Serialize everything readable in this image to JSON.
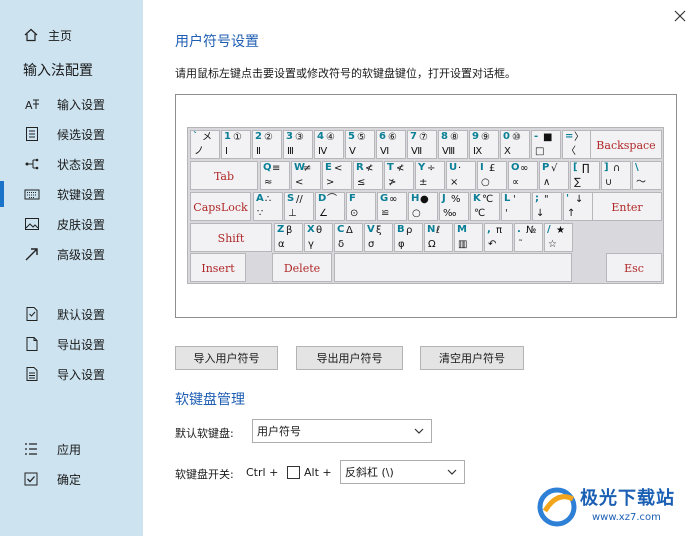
{
  "sidebar": {
    "home": "主页",
    "heading": "输入法配置",
    "items": [
      {
        "label": "输入设置",
        "icon": "input-settings-icon"
      },
      {
        "label": "候选设置",
        "icon": "candidate-list-icon"
      },
      {
        "label": "状态设置",
        "icon": "status-icon"
      },
      {
        "label": "软键设置",
        "icon": "keyboard-icon"
      },
      {
        "label": "皮肤设置",
        "icon": "image-icon"
      },
      {
        "label": "高级设置",
        "icon": "arrow-icon"
      }
    ],
    "lower": [
      {
        "label": "默认设置",
        "icon": "default-doc-icon"
      },
      {
        "label": "导出设置",
        "icon": "export-doc-icon"
      },
      {
        "label": "导入设置",
        "icon": "import-doc-icon"
      }
    ],
    "bottom": [
      {
        "label": "应用",
        "icon": "apply-list-icon"
      },
      {
        "label": "确定",
        "icon": "confirm-check-icon"
      }
    ]
  },
  "main": {
    "title": "用户符号设置",
    "instruction": "请用鼠标左键点击要设置或修改符号的软键盘键位，打开设置对话框。"
  },
  "keyboard": {
    "row1": [
      {
        "k": "`",
        "a": "メ",
        "b": "ノ",
        "c": ""
      },
      {
        "k": "1",
        "a": "①",
        "b": "Ⅰ",
        "c": ""
      },
      {
        "k": "2",
        "a": "②",
        "b": "Ⅱ",
        "c": ""
      },
      {
        "k": "3",
        "a": "③",
        "b": "Ⅲ",
        "c": ""
      },
      {
        "k": "4",
        "a": "④",
        "b": "Ⅳ",
        "c": ""
      },
      {
        "k": "5",
        "a": "⑤",
        "b": "Ⅴ",
        "c": ""
      },
      {
        "k": "6",
        "a": "⑥",
        "b": "Ⅵ",
        "c": ""
      },
      {
        "k": "7",
        "a": "⑦",
        "b": "Ⅶ",
        "c": ""
      },
      {
        "k": "8",
        "a": "⑧",
        "b": "Ⅷ",
        "c": ""
      },
      {
        "k": "9",
        "a": "⑨",
        "b": "Ⅸ",
        "c": ""
      },
      {
        "k": "0",
        "a": "⑩",
        "b": "Ⅹ",
        "c": ""
      },
      {
        "k": "-",
        "a": "■",
        "b": "□",
        "c": ""
      },
      {
        "k": "=",
        "a": "〉",
        "b": "〈",
        "c": ""
      }
    ],
    "row2": [
      {
        "k": "Q",
        "a": "≡",
        "b": "≈",
        "c": ""
      },
      {
        "k": "W",
        "a": "≠",
        "b": "<",
        "c": ""
      },
      {
        "k": "E",
        "a": "<",
        "b": ">",
        "c": ""
      },
      {
        "k": "R",
        "a": "≮",
        "b": "≤",
        "c": ""
      },
      {
        "k": "T",
        "a": "≮",
        "b": "≯",
        "c": ""
      },
      {
        "k": "Y",
        "a": "÷",
        "b": "±",
        "c": ""
      },
      {
        "k": "U",
        "a": "·",
        "b": "×",
        "c": ""
      },
      {
        "k": "I",
        "a": "£",
        "b": "○",
        "c": ""
      },
      {
        "k": "O",
        "a": "∞",
        "b": "∝",
        "c": ""
      },
      {
        "k": "P",
        "a": "√",
        "b": "∧",
        "c": ""
      },
      {
        "k": "[",
        "a": "∏",
        "b": "∑",
        "c": ""
      },
      {
        "k": "]",
        "a": "∩",
        "b": "∪",
        "c": ""
      },
      {
        "k": "\\",
        "a": "",
        "b": "～",
        "c": ""
      }
    ],
    "row3": [
      {
        "k": "A",
        "a": "∴",
        "b": "∵",
        "c": ""
      },
      {
        "k": "S",
        "a": "//",
        "b": "⊥",
        "c": ""
      },
      {
        "k": "D",
        "a": "⌒",
        "b": "∠",
        "c": ""
      },
      {
        "k": "F",
        "a": "",
        "b": "⊙",
        "c": ""
      },
      {
        "k": "G",
        "a": "∞",
        "b": "≌",
        "c": ""
      },
      {
        "k": "H",
        "a": "●",
        "b": "○",
        "c": ""
      },
      {
        "k": "J",
        "a": "%",
        "b": "‰",
        "c": ""
      },
      {
        "k": "K",
        "a": "℃",
        "b": "℃",
        "c": ""
      },
      {
        "k": "L",
        "a": "'",
        "b": "'",
        "c": ""
      },
      {
        "k": ";",
        "a": "\"",
        "b": "↓",
        "c": ""
      },
      {
        "k": "'",
        "a": "↓",
        "b": "↑",
        "c": ""
      }
    ],
    "row4": [
      {
        "k": "Z",
        "a": "β",
        "b": "α",
        "c": ""
      },
      {
        "k": "X",
        "a": "θ",
        "b": "γ",
        "c": ""
      },
      {
        "k": "C",
        "a": "Δ",
        "b": "δ",
        "c": ""
      },
      {
        "k": "V",
        "a": "ξ",
        "b": "σ",
        "c": ""
      },
      {
        "k": "B",
        "a": "ρ",
        "b": "φ",
        "c": ""
      },
      {
        "k": "N",
        "a": "ℓ",
        "b": "Ω",
        "c": ""
      },
      {
        "k": "M",
        "a": "",
        "b": "▥",
        "c": ""
      },
      {
        "k": ",",
        "a": "π",
        "b": "↶",
        "c": ""
      },
      {
        "k": ".",
        "a": "№",
        "b": "˜",
        "c": ""
      },
      {
        "k": "/",
        "a": "★",
        "b": "☆",
        "c": ""
      }
    ],
    "fn": {
      "backspace": "Backspace",
      "tab": "Tab",
      "capslock": "CapsLock",
      "enter": "Enter",
      "shift": "Shift",
      "insert": "Insert",
      "delete": "Delete",
      "esc": "Esc"
    }
  },
  "buttons": {
    "import": "导入用户符号",
    "export": "导出用户符号",
    "clear": "清空用户符号"
  },
  "manage": {
    "title": "软键盘管理",
    "default_label": "默认软键盘:",
    "default_value": "用户符号",
    "switch_label": "软键盘开关:",
    "ctrl": "Ctrl +",
    "alt": "Alt +",
    "switch_value": "反斜杠  (\\)"
  },
  "watermark": {
    "text": "极光下载站",
    "url": "www.xz7.com"
  },
  "colors": {
    "sidebar_bg": "#cde3f0",
    "accent": "#1f5fb3",
    "key_label": "#0a7f96",
    "fn_label": "#b02828"
  }
}
